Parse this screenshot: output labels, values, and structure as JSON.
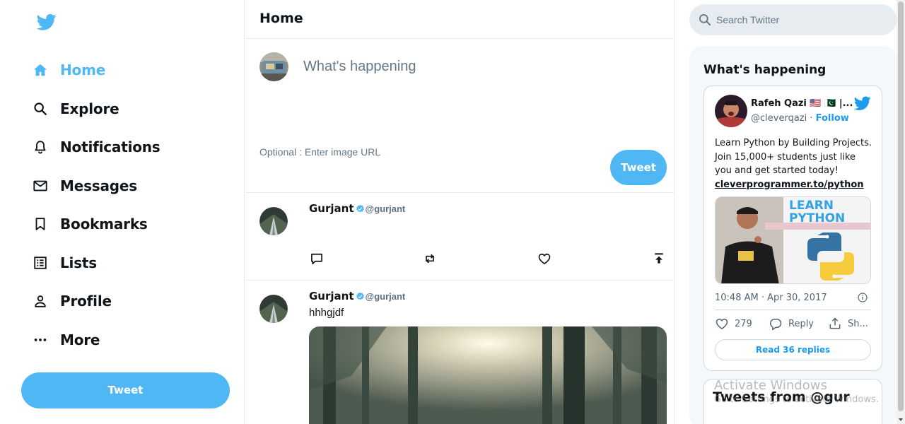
{
  "colors": {
    "accent": "#50b7f5",
    "link": "#1d9bf0",
    "border": "#e6ecf0"
  },
  "sidebar": {
    "logo_icon": "twitter-bird-icon",
    "items": [
      {
        "label": "Home",
        "icon": "home-icon",
        "active": true
      },
      {
        "label": "Explore",
        "icon": "search-icon"
      },
      {
        "label": "Notifications",
        "icon": "bell-icon"
      },
      {
        "label": "Messages",
        "icon": "mail-icon"
      },
      {
        "label": "Bookmarks",
        "icon": "bookmark-icon"
      },
      {
        "label": "Lists",
        "icon": "list-icon"
      },
      {
        "label": "Profile",
        "icon": "person-icon"
      },
      {
        "label": "More",
        "icon": "more-icon"
      }
    ],
    "tweet_button": "Tweet"
  },
  "feed": {
    "title": "Home",
    "tweetbox": {
      "placeholder": "What's happening",
      "image_placeholder": "Optional : Enter image URL",
      "button": "Tweet"
    },
    "posts": [
      {
        "name": "Gurjant",
        "handle": "@gurjant",
        "text": ""
      },
      {
        "name": "Gurjant",
        "handle": "@gurjant",
        "text": "hhhgjdf"
      }
    ]
  },
  "widgets": {
    "search_placeholder": "Search Twitter",
    "title": "What's happening",
    "embed": {
      "name": "Rafeh Qazi 🇺🇸 🇵🇰 |...",
      "handle": "@cleverqazi",
      "separator": " · ",
      "follow": "Follow",
      "body": "Learn Python by Building Projects. Join 15,000+ students just like you and get started today!",
      "link": "cleverprogrammer.to/python",
      "card_title_1": "LEARN",
      "card_title_2": "PYTHON",
      "timestamp": "10:48 AM · Apr 30, 2017",
      "likes": "279",
      "reply": "Reply",
      "share": "Sh...",
      "read_replies": "Read 36 replies"
    },
    "timeline_title": "Tweets from @gur"
  },
  "watermark": {
    "line1": "Activate Windows",
    "line2": "Go to Settings to activate Windows."
  }
}
